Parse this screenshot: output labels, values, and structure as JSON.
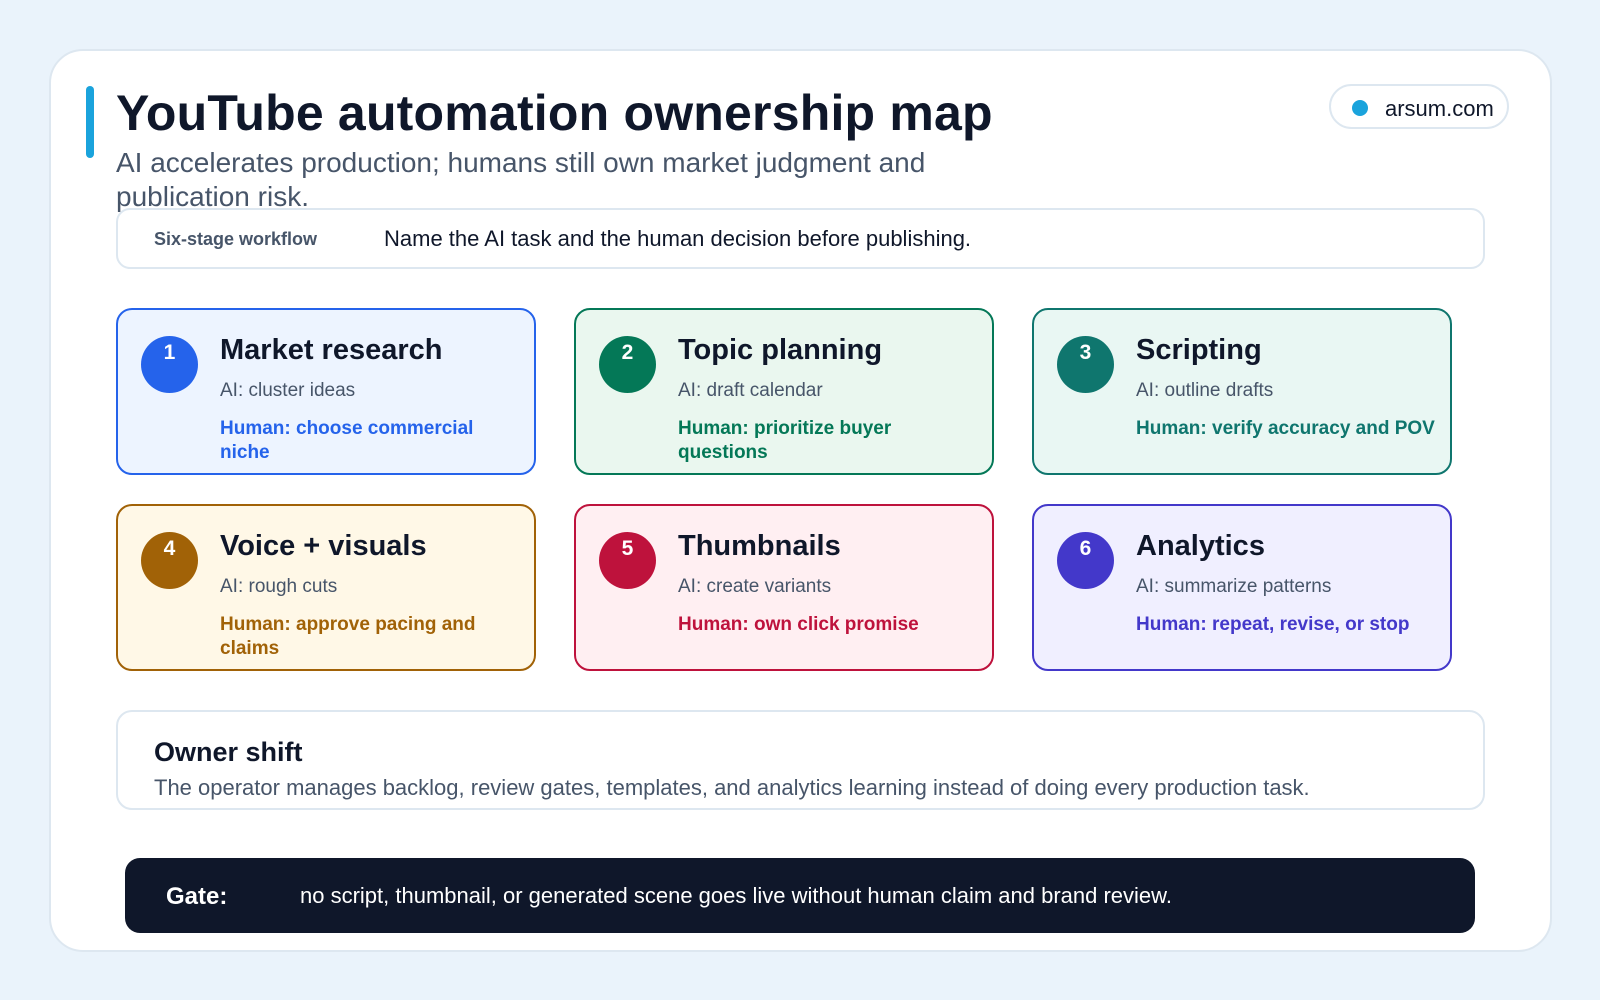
{
  "header": {
    "title": "YouTube automation ownership map",
    "subtitle": "AI accelerates production; humans still own market judgment and publication risk.",
    "brand": "arsum.com"
  },
  "workflow": {
    "label": "Six-stage workflow",
    "text": "Name the AI task and the human decision before publishing."
  },
  "stages": [
    {
      "num": "1",
      "title": "Market research",
      "ai": "AI: cluster ideas",
      "human": "Human: choose commercial niche",
      "color": "#2563eb",
      "bg": "#edf4ff"
    },
    {
      "num": "2",
      "title": "Topic planning",
      "ai": "AI: draft calendar",
      "human": "Human: prioritize buyer questions",
      "color": "#047857",
      "bg": "#eaf7ef"
    },
    {
      "num": "3",
      "title": "Scripting",
      "ai": "AI: outline drafts",
      "human": "Human: verify accuracy and POV",
      "color": "#0f766e",
      "bg": "#e9f7f3"
    },
    {
      "num": "4",
      "title": "Voice + visuals",
      "ai": "AI: rough cuts",
      "human": "Human: approve pacing and claims",
      "color": "#a16207",
      "bg": "#fff8e7"
    },
    {
      "num": "5",
      "title": "Thumbnails",
      "ai": "AI: create variants",
      "human": "Human: own click promise",
      "color": "#be123c",
      "bg": "#ffeff2"
    },
    {
      "num": "6",
      "title": "Analytics",
      "ai": "AI: summarize patterns",
      "human": "Human: repeat, revise, or stop",
      "color": "#4338ca",
      "bg": "#f0efff"
    }
  ],
  "owner_shift": {
    "title": "Owner shift",
    "text": "The operator manages backlog, review gates, templates, and analytics learning instead of doing every production task."
  },
  "gate": {
    "label": "Gate:",
    "text": "no script, thumbnail, or generated scene goes live without human claim and brand review."
  }
}
